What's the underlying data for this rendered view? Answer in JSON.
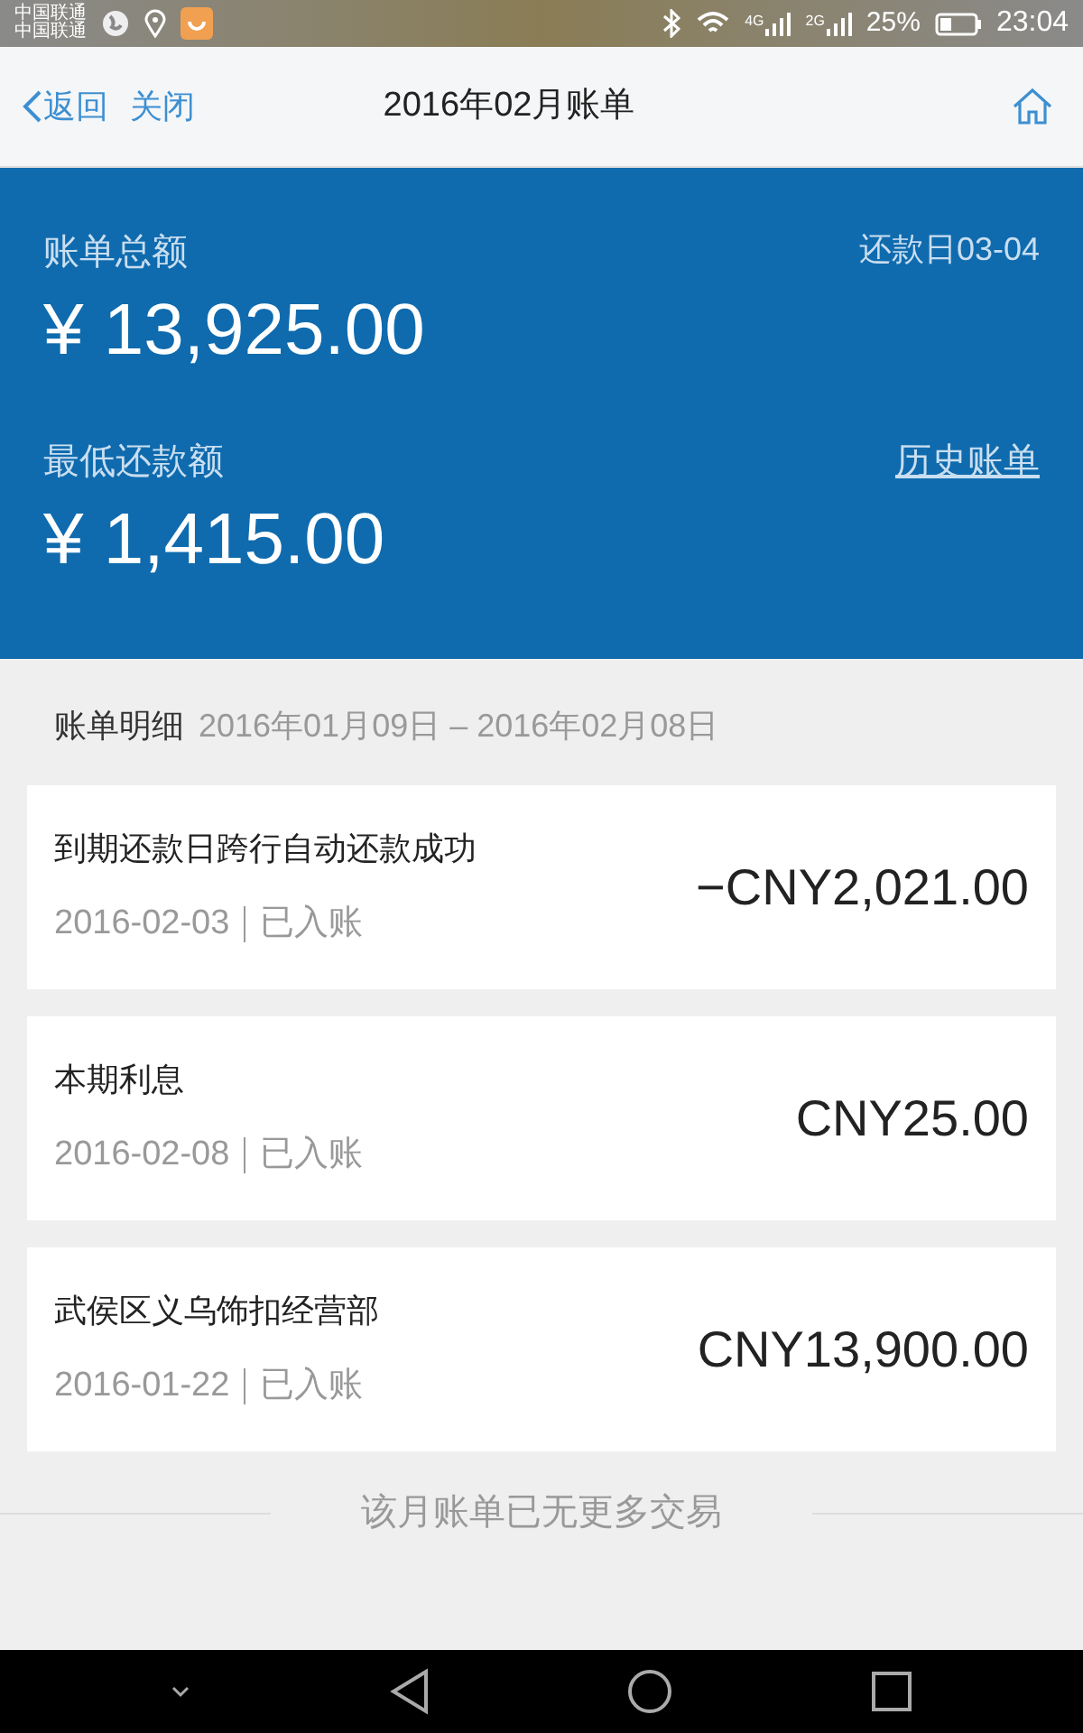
{
  "status_bar": {
    "carriers": [
      "中国联通",
      "中国联通"
    ],
    "network_labels": [
      "4G",
      "2G"
    ],
    "battery": "25%",
    "time": "23:04"
  },
  "nav": {
    "back": "返回",
    "close": "关闭",
    "title": "2016年02月账单"
  },
  "summary": {
    "total_label": "账单总额",
    "due_date": "还款日03-04",
    "total": "¥ 13,925.00",
    "min_label": "最低还款额",
    "history_link": "历史账单",
    "min": "¥ 1,415.00"
  },
  "details": {
    "heading": "账单明细",
    "period": "2016年01月09日 – 2016年02月08日"
  },
  "transactions": [
    {
      "title": "到期还款日跨行自动还款成功",
      "date": "2016-02-03",
      "status": "已入账",
      "amount": "−CNY2,021.00"
    },
    {
      "title": "本期利息",
      "date": "2016-02-08",
      "status": "已入账",
      "amount": "CNY25.00"
    },
    {
      "title": "武侯区义乌饰扣经营部",
      "date": "2016-01-22",
      "status": "已入账",
      "amount": "CNY13,900.00"
    }
  ],
  "footer": "该月账单已无更多交易"
}
